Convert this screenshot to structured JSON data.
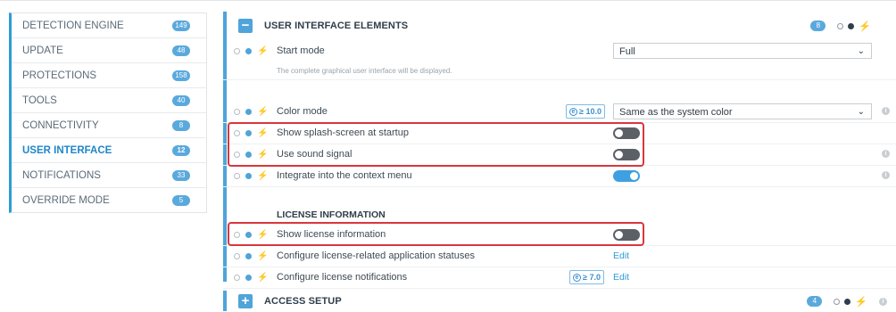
{
  "sidebar": {
    "items": [
      {
        "label": "DETECTION ENGINE",
        "count": "149"
      },
      {
        "label": "UPDATE",
        "count": "48"
      },
      {
        "label": "PROTECTIONS",
        "count": "158"
      },
      {
        "label": "TOOLS",
        "count": "40"
      },
      {
        "label": "CONNECTIVITY",
        "count": "8"
      },
      {
        "label": "USER INTERFACE",
        "count": "12"
      },
      {
        "label": "NOTIFICATIONS",
        "count": "33"
      },
      {
        "label": "OVERRIDE MODE",
        "count": "5"
      }
    ]
  },
  "section_ui": {
    "title": "USER INTERFACE ELEMENTS",
    "count": "8",
    "toggle_symbol": "−",
    "start_mode": {
      "label": "Start mode",
      "value": "Full",
      "hint": "The complete graphical user interface will be displayed."
    },
    "color_mode": {
      "label": "Color mode",
      "version_badge": "≥ 10.0",
      "value": "Same as the system color"
    },
    "splash": {
      "label": "Show splash-screen at startup",
      "state": "off"
    },
    "sound": {
      "label": "Use sound signal",
      "state": "off"
    },
    "context_menu": {
      "label": "Integrate into the context menu",
      "state": "on"
    }
  },
  "license": {
    "title": "LICENSE INFORMATION",
    "show_license": {
      "label": "Show license information",
      "state": "off"
    },
    "statuses": {
      "label": "Configure license-related application statuses",
      "action": "Edit"
    },
    "notifications": {
      "label": "Configure license notifications",
      "version_badge": "≥ 7.0",
      "action": "Edit"
    }
  },
  "section_access": {
    "title": "ACCESS SETUP",
    "count": "4",
    "toggle_symbol": "+"
  },
  "glyphs": {
    "bolt": "⚡",
    "chevron": "⌄",
    "info": "i",
    "e": "e"
  },
  "colors": {
    "accent": "#4fa4da",
    "highlight": "#d9363e",
    "toggle_on": "#3ea0e0",
    "toggle_off": "#5b6067"
  }
}
